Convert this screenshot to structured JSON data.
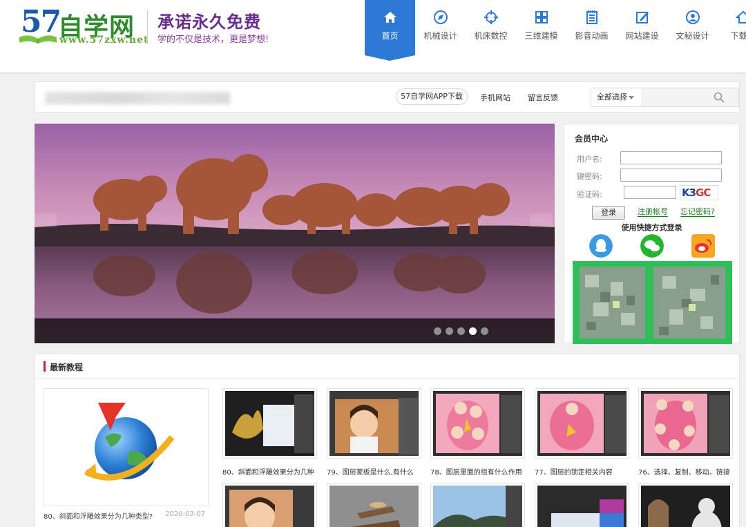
{
  "logo": {
    "number": "57",
    "name": "自学网",
    "url": "www.57zxw.net"
  },
  "slogan": {
    "main": "承诺永久免费",
    "sub": "学的不仅是技术，更是梦想!"
  },
  "nav": [
    {
      "label": "首页",
      "icon": "home-icon",
      "active": true
    },
    {
      "label": "机械设计",
      "icon": "compass-icon"
    },
    {
      "label": "机床数控",
      "icon": "crosshair-icon"
    },
    {
      "label": "三维建模",
      "icon": "grid-icon"
    },
    {
      "label": "影音动画",
      "icon": "notepad-icon"
    },
    {
      "label": "网站建设",
      "icon": "edit-icon"
    },
    {
      "label": "文秘设计",
      "icon": "user-circle-icon"
    },
    {
      "label": "下载中",
      "icon": "download-home-icon"
    }
  ],
  "subbar": {
    "app_download": "57自学网APP下载",
    "mobile_site": "手机网站",
    "feedback": "留言反馈",
    "search_select": "全部选择",
    "search_placeholder": ""
  },
  "banner": {
    "slides": 5,
    "active_slide": 4
  },
  "member": {
    "title": "会员中心",
    "username_label": "用户名:",
    "password_label": "键密码:",
    "captcha_label": "验证码:",
    "captcha_text_a": "K3",
    "captcha_text_b": "GC",
    "login": "登录",
    "register": "注册帐号",
    "forgot": "忘记密码?",
    "quick_login": "使用快捷方式登录"
  },
  "latest": {
    "title": "最新教程",
    "feature": {
      "caption": "80、斜面和浮雕效果分为几种类型?",
      "date": "2020-03-07"
    },
    "items": [
      {
        "caption": "80、斜面和浮雕效果分为几种"
      },
      {
        "caption": "79、图层蒙板是什么,有什么"
      },
      {
        "caption": "78、图层里面的组有什么作用"
      },
      {
        "caption": "77、图层的锁定相关内容"
      },
      {
        "caption": "76、选择、复制、移动、链接"
      }
    ]
  }
}
